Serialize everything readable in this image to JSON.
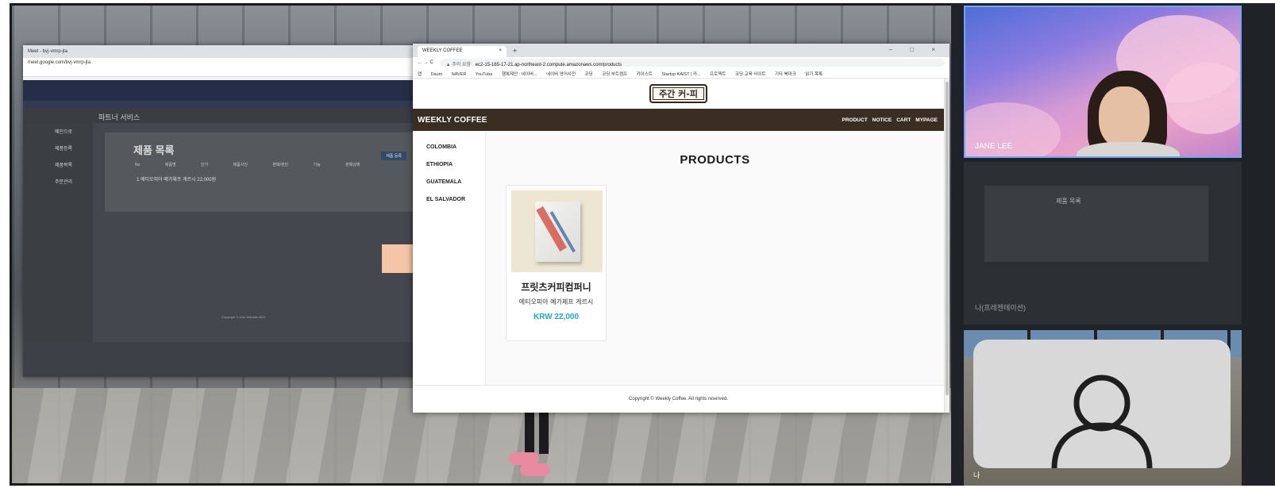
{
  "background_window": {
    "tab_title": "Meet - bvj-vmrp-jta",
    "url": "meet.google.com/bvj-vmrp-jta",
    "app_title": "파트너 서비스",
    "sidebar": [
      "메인으로",
      "제품등록",
      "제품목록",
      "주문관리"
    ],
    "panel_title": "제품 목록",
    "columns": "No 제품명 단가 제품사진 판매/판단 기능 판매상태",
    "row": "1 에티오피아 예가체프 게르시 22,000원",
    "register_button": "제품 등록",
    "copyright": "Copyright © Your Website 2021"
  },
  "browser": {
    "tab_title": "WEEKLY COFFEE",
    "tab_close": "×",
    "new_tab": "+",
    "window_controls": "– □ ×",
    "nav_buttons": "← → C",
    "security_label": "▲ 주의 요함",
    "url": "ec2-15-165-17-21.ap-northeast-2.compute.amazonaws.com/products",
    "bookmarks": [
      "앱",
      "Daum",
      "NAVER",
      "YouTube",
      "행복제안 : 네이버...",
      "네이버 영어사전",
      "코딩",
      "코딩 부트캠프",
      "카이스트",
      "Startup KAIST | 카...",
      "프로젝트",
      "코딩 교육 사이트",
      "기타 북마크",
      "읽기 목록"
    ]
  },
  "site": {
    "logo_text": "주간 커-피",
    "brand": "WEEKLY COFFEE",
    "nav": [
      "PRODUCT",
      "NOTICE",
      "CART",
      "MYPAGE"
    ],
    "categories": [
      "COLOMBIA",
      "ETHIOPIA",
      "GUATEMALA",
      "EL SALVADOR"
    ],
    "page_title": "PRODUCTS",
    "product": {
      "name": "프릿츠커피컴퍼니",
      "description": "에티오피아 예가체프 게르시",
      "price": "KRW 22,000"
    },
    "footer": "Copyright © Weekly Coffee. All rights reserved."
  },
  "participants": {
    "tile1_name": "JANE LEE",
    "tile2_name": "나(프레젠테이션)",
    "tile3_name": "나"
  },
  "colors": {
    "nav_bg": "#3a2e23",
    "price": "#1aa9c5",
    "arrow": "#f5c6a5",
    "active_tile_border": "#6ea8f5"
  }
}
